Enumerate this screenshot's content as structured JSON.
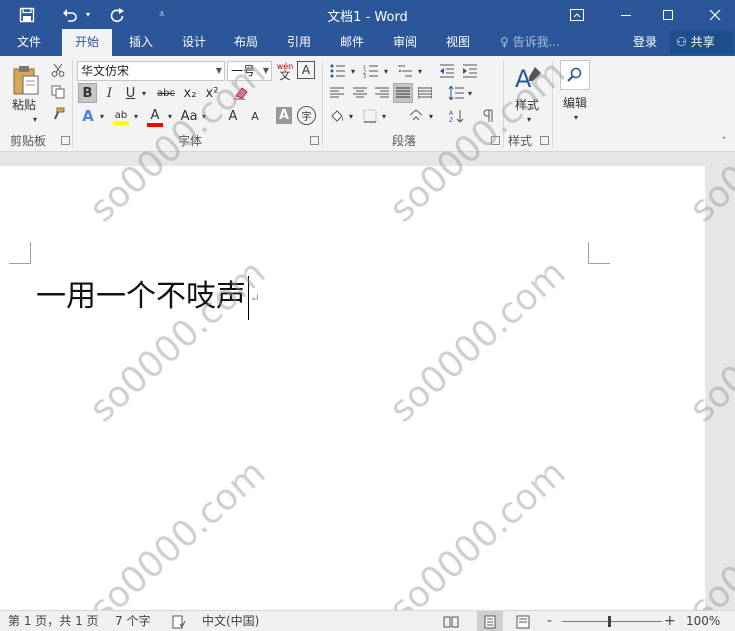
{
  "titlebar": {
    "title": "文档1 - Word",
    "save_icon": "save-icon",
    "undo_icon": "undo-icon",
    "redo_icon": "redo-icon",
    "customize_icon": "customize-qat-icon",
    "ribbon_display_icon": "ribbon-display-options-icon",
    "minimize_icon": "minimize-icon",
    "maximize_icon": "maximize-icon",
    "close_icon": "close-icon"
  },
  "tabs": [
    {
      "label": "文件",
      "active": false
    },
    {
      "label": "开始",
      "active": true
    },
    {
      "label": "插入",
      "active": false
    },
    {
      "label": "设计",
      "active": false
    },
    {
      "label": "布局",
      "active": false
    },
    {
      "label": "引用",
      "active": false
    },
    {
      "label": "邮件",
      "active": false
    },
    {
      "label": "审阅",
      "active": false
    },
    {
      "label": "视图",
      "active": false
    }
  ],
  "tell_me": {
    "placeholder": "告诉我..."
  },
  "account": {
    "login_label": "登录",
    "share_label": "共享"
  },
  "ribbon": {
    "clipboard": {
      "label": "剪贴板",
      "paste_label": "粘贴"
    },
    "font": {
      "label": "字体",
      "font_name": "华文仿宋",
      "font_size": "一号",
      "phonetic_label": "wén",
      "bold": "B",
      "italic": "I",
      "underline": "U",
      "strikethrough": "abc",
      "subscript": "x₂",
      "superscript": "x²",
      "change_case": "Aa",
      "grow_font": "A",
      "shrink_font": "A",
      "char_shading": "A",
      "enclose_char": "字",
      "border_char": "A"
    },
    "paragraph": {
      "label": "段落"
    },
    "styles": {
      "label": "样式",
      "styles_label": "样式"
    },
    "editing": {
      "editing_label": "编辑"
    }
  },
  "document": {
    "text": "一用一个不吱声",
    "watermark_text": "so0000.com"
  },
  "statusbar": {
    "page_info": "第 1 页，共 1 页",
    "word_count": "7 个字",
    "language": "中文(中国)",
    "zoom_minus": "-",
    "zoom_plus": "+",
    "zoom_level": "100%"
  },
  "colors": {
    "accent": "#2b579a",
    "highlight": "#ffff00",
    "font_color": "#ff0000"
  }
}
